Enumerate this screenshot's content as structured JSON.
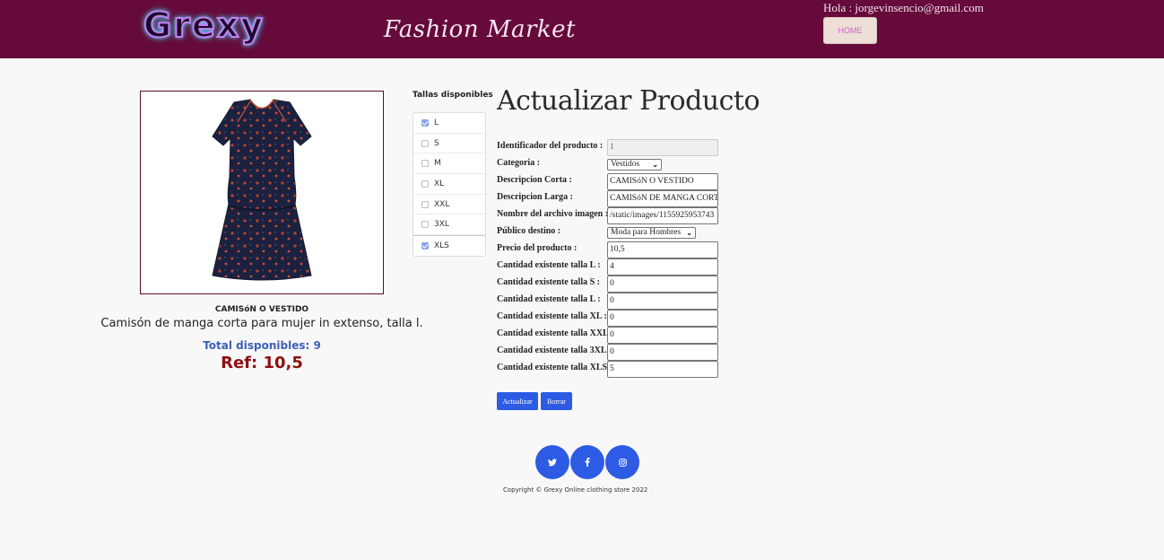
{
  "header": {
    "logo": "Grexy",
    "tagline": "Fashion Market",
    "greeting": "Hola : jorgevinsencio@gmail.com",
    "home_label": "HOME"
  },
  "product": {
    "image_alt": "dress",
    "short_description": "CAMISóN O VESTIDO",
    "long_description": "Camisón de manga corta para mujer in extenso, talla l.",
    "total_available": "Total disponibles: 9",
    "ref": "Ref: 10,5"
  },
  "sizes": {
    "title": "Tallas disponibles",
    "items": [
      {
        "label": "L",
        "checked": true
      },
      {
        "label": "S",
        "checked": false
      },
      {
        "label": "M",
        "checked": false
      },
      {
        "label": "XL",
        "checked": false
      },
      {
        "label": "XXL",
        "checked": false
      },
      {
        "label": "3XL",
        "checked": false
      },
      {
        "label": "XLS",
        "checked": true
      }
    ]
  },
  "form": {
    "title": "Actualizar Producto",
    "fields": [
      {
        "label": "Identificador del producto :",
        "value": "1",
        "type": "input-disabled"
      },
      {
        "label": "Categoria :",
        "value": "Vestidos",
        "type": "select"
      },
      {
        "label": "Descripcion Corta :",
        "value": "CAMISóN O VESTIDO",
        "type": "input"
      },
      {
        "label": "Descripcion Larga :",
        "value": "CAMISóN DE MANGA CORTA",
        "type": "input"
      },
      {
        "label": "Nombre del archivo imagen :",
        "value": "/static/images/1155925953743",
        "type": "input"
      },
      {
        "label": "Público destino :",
        "value": "Moda para Hombres",
        "type": "select"
      },
      {
        "label": "Precio del producto :",
        "value": "10,5",
        "type": "input"
      },
      {
        "label": "Cantidad existente talla L :",
        "value": "4",
        "type": "input"
      },
      {
        "label": "Cantidad existente talla S :",
        "value": "0",
        "type": "input"
      },
      {
        "label": "Cantidad existente talla L :",
        "value": "0",
        "type": "input"
      },
      {
        "label": "Cantidad existente talla XL :",
        "value": "0",
        "type": "input"
      },
      {
        "label": "Cantidad existente talla XXL:",
        "value": "0",
        "type": "input"
      },
      {
        "label": "Cantidad existente talla 3XL:",
        "value": "0",
        "type": "input"
      },
      {
        "label": "Cantidad existente talla XLS:",
        "value": "5",
        "type": "input"
      }
    ],
    "update_label": "Actualizar",
    "delete_label": "Borrar"
  },
  "footer": {
    "social_icons": [
      "twitter-icon",
      "facebook-icon",
      "instagram-icon"
    ],
    "copyright": "Copyright © Grexy Online clothing store 2022"
  },
  "colors": {
    "header_bg": "#650a3a",
    "button_blue": "#2d5be3",
    "ref_red": "#8e1010",
    "total_blue": "#3d5fb8"
  }
}
